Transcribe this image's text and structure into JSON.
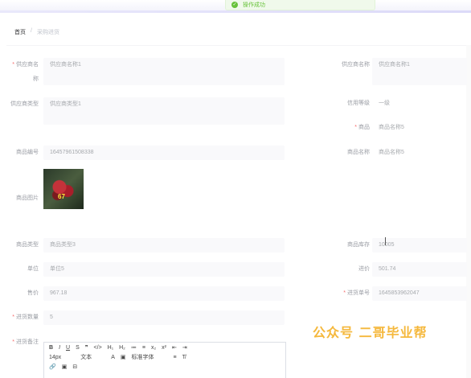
{
  "toast": {
    "message": "操作成功",
    "icon": "check-circle-icon",
    "color": "#67c23a"
  },
  "breadcrumb": {
    "home": "首页",
    "separator": "/",
    "current": "采购进货"
  },
  "form": {
    "supplier_name": {
      "label": "供应商名称",
      "value": "供应商名称1",
      "required": true
    },
    "supplier_name_right": {
      "label": "供应商名称",
      "value": "供应商名称1"
    },
    "supplier_type": {
      "label": "供应商类型",
      "value": "供应商类型1"
    },
    "credit_level": {
      "label": "信用等级",
      "value": "一级"
    },
    "product": {
      "label": "商品",
      "value": "商品名称5",
      "required": true
    },
    "product_code": {
      "label": "商品编号",
      "value": "16457961508338"
    },
    "product_name": {
      "label": "商品名称",
      "value": "商品名称5"
    },
    "product_image": {
      "label": "商品图片",
      "overlay_text": "67"
    },
    "product_category": {
      "label": "商品类型",
      "value": "商品类型3"
    },
    "stock": {
      "label": "商品库存",
      "value": "10005"
    },
    "unit": {
      "label": "单位",
      "value": "单位5"
    },
    "purchase_price": {
      "label": "进价",
      "value": "501.74"
    },
    "sale_price": {
      "label": "售价",
      "value": "967.18"
    },
    "order_no": {
      "label": "进货单号",
      "value": "1645853962047",
      "required": true
    },
    "quantity": {
      "label": "进货数量",
      "value": "5",
      "required": true
    },
    "remark": {
      "label": "进货备注",
      "required": true
    }
  },
  "editor": {
    "row1": [
      "B",
      "I",
      "U",
      "S",
      "❞",
      "</>",
      "H₁",
      "H₂",
      "≔",
      "≡",
      "x₂",
      "x²",
      "⇤",
      "⇥"
    ],
    "font_size": "14px",
    "text_style": "文本",
    "font_family": "标准字体",
    "row3": [
      "🔗",
      "▣",
      "⊟"
    ]
  },
  "watermark": "公众号  二哥毕业帮"
}
